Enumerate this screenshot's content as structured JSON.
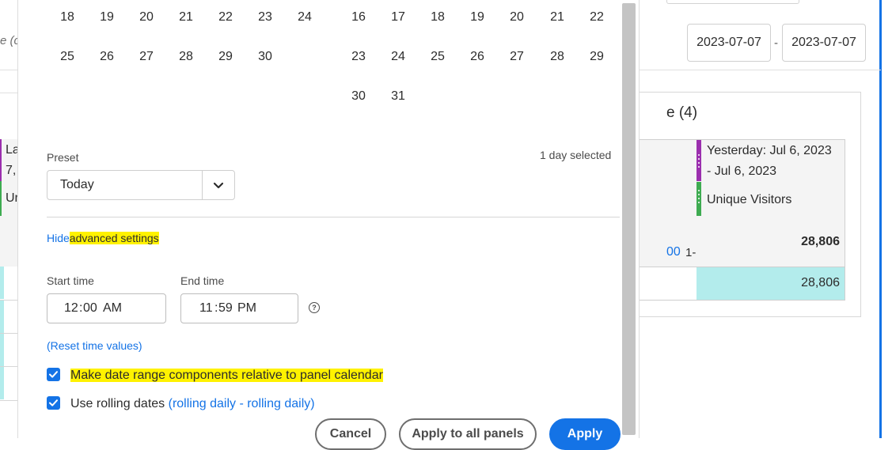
{
  "background": {
    "date_range": {
      "start": "2023-07-07",
      "separator": "-",
      "end": "2023-07-07"
    },
    "left_fragments": {
      "italic": "e (c",
      "cell_a_line1": "La",
      "cell_a_line2": "7,",
      "cell_b": "Ur"
    },
    "freeform": {
      "title_fragment": "e (4)",
      "segment_label_line1": "Yesterday: Jul 6, 2023",
      "segment_label_line2": "- Jul 6, 2023",
      "metric_label": "Unique Visitors",
      "total_link_fragment": "00",
      "total_small_fragment": "1-",
      "total_value": "28,806",
      "row_value": "28,806",
      "colors": {
        "segment": "#9b2fae",
        "metric": "#3eab51",
        "cell_fill": "#b3ecec"
      }
    }
  },
  "calendar": {
    "left_month": {
      "rows": [
        [
          "18",
          "19",
          "20",
          "21",
          "22",
          "23",
          "24"
        ],
        [
          "25",
          "26",
          "27",
          "28",
          "29",
          "30"
        ]
      ]
    },
    "right_month": {
      "rows": [
        [
          "16",
          "17",
          "18",
          "19",
          "20",
          "21",
          "22"
        ],
        [
          "23",
          "24",
          "25",
          "26",
          "27",
          "28",
          "29"
        ],
        [
          "30",
          "31"
        ]
      ]
    }
  },
  "preset": {
    "label": "Preset",
    "value": "Today",
    "chevron_icon": "chevron-down-icon"
  },
  "selection_summary": "1 day selected",
  "advanced": {
    "toggle_prefix": "Hide",
    "toggle_highlight": "advanced settings",
    "start_time_label": "Start time",
    "start_time": {
      "hour": "12",
      "minute": "00",
      "ampm": "AM"
    },
    "end_time_label": "End time",
    "end_time": {
      "hour": "11",
      "minute": "59",
      "ampm": "PM"
    },
    "help_icon": "help-icon",
    "reset_link": "(Reset time values)"
  },
  "options": {
    "relative_label": "Make date range components relative to panel calendar",
    "relative_checked": true,
    "rolling_label": "Use rolling dates",
    "rolling_link": "(rolling daily - rolling daily)",
    "rolling_checked": true
  },
  "buttons": {
    "cancel": "Cancel",
    "apply_all": "Apply to all panels",
    "apply": "Apply"
  },
  "colors": {
    "accent": "#1473e6",
    "highlight": "#fff200"
  }
}
